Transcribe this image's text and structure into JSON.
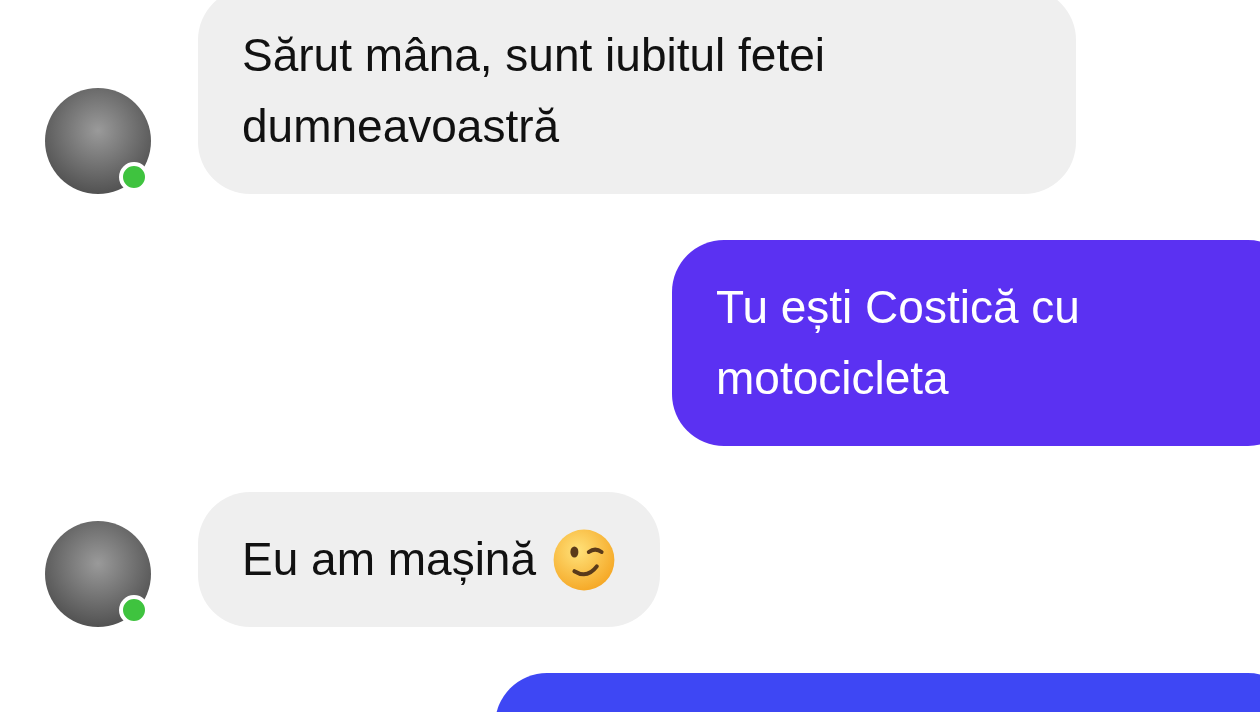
{
  "messages": [
    {
      "kind": "incoming",
      "text": "Sărut mâna, sunt iubitul fetei dumneavoastră",
      "online": true
    },
    {
      "kind": "outgoing",
      "text": "Tu ești Costică cu motocicleta",
      "color": "#5b31f2"
    },
    {
      "kind": "incoming",
      "text": "Eu am mașină",
      "emoji": {
        "kind": "wink"
      },
      "online": true
    },
    {
      "kind": "outgoing",
      "color": "#3e47f4"
    }
  ]
}
